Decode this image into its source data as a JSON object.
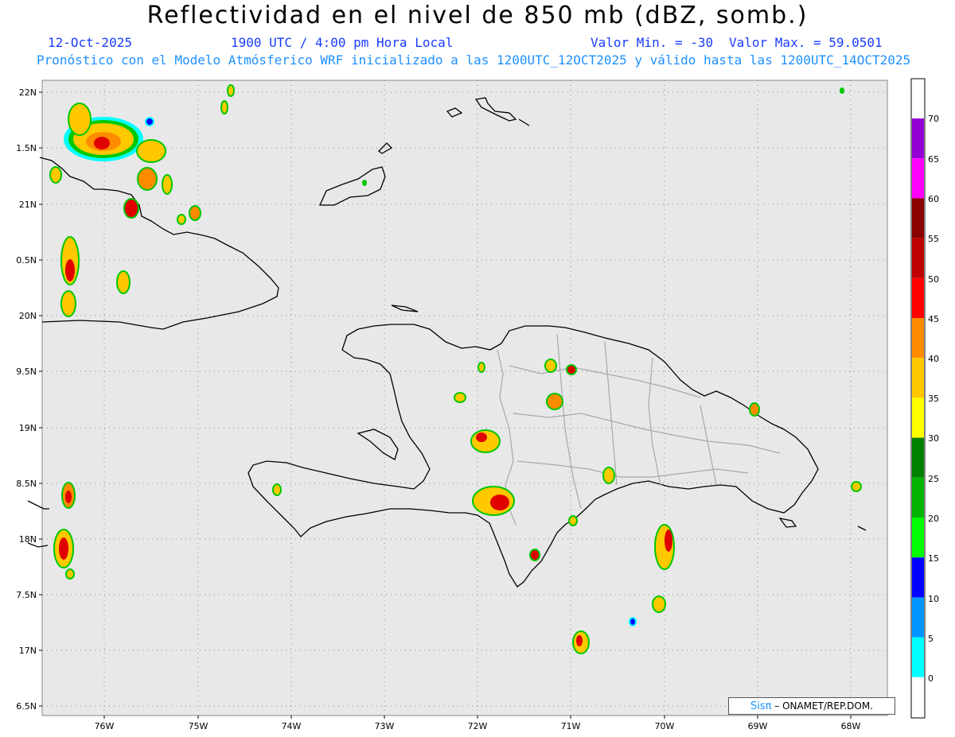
{
  "header": {
    "title": "Reflectividad en el nivel de 850 mb (dBZ, somb.)",
    "date": "12-Oct-2025",
    "time": "1900 UTC / 4:00 pm Hora Local",
    "min_label": "Valor Min. = -30",
    "max_label": "Valor Max. = 59.0501",
    "model_line": "Pronóstico con el Modelo Atmósferico WRF inicializado a las 1200UTC_12OCT2025 y válido hasta las  1200UTC_14OCT2025"
  },
  "map": {
    "lat_labels": [
      "22N",
      "1.5N",
      "21N",
      "0.5N",
      "20N",
      "9.5N",
      "19N",
      "8.5N",
      "18N",
      "7.5N",
      "17N",
      "6.5N"
    ],
    "lon_labels": [
      "76W",
      "75W",
      "74W",
      "73W",
      "72W",
      "71W",
      "70W",
      "69W",
      "68W"
    ]
  },
  "colorbar": {
    "labels": [
      "70",
      "65",
      "60",
      "55",
      "50",
      "45",
      "40",
      "35",
      "30",
      "25",
      "20",
      "15",
      "10",
      "5",
      "0"
    ],
    "colors": [
      "#9400d3",
      "#ff00ff",
      "#8b0000",
      "#c00000",
      "#ff0000",
      "#ff8c00",
      "#ffc800",
      "#ffff00",
      "#008000",
      "#00b400",
      "#00ff00",
      "#0000ff",
      "#0096ff",
      "#00ffff",
      "#ffffff",
      "#e6e6e6"
    ]
  },
  "credit": {
    "logo": "Sisπ",
    "text": " – ONAMET/REP.DOM."
  }
}
